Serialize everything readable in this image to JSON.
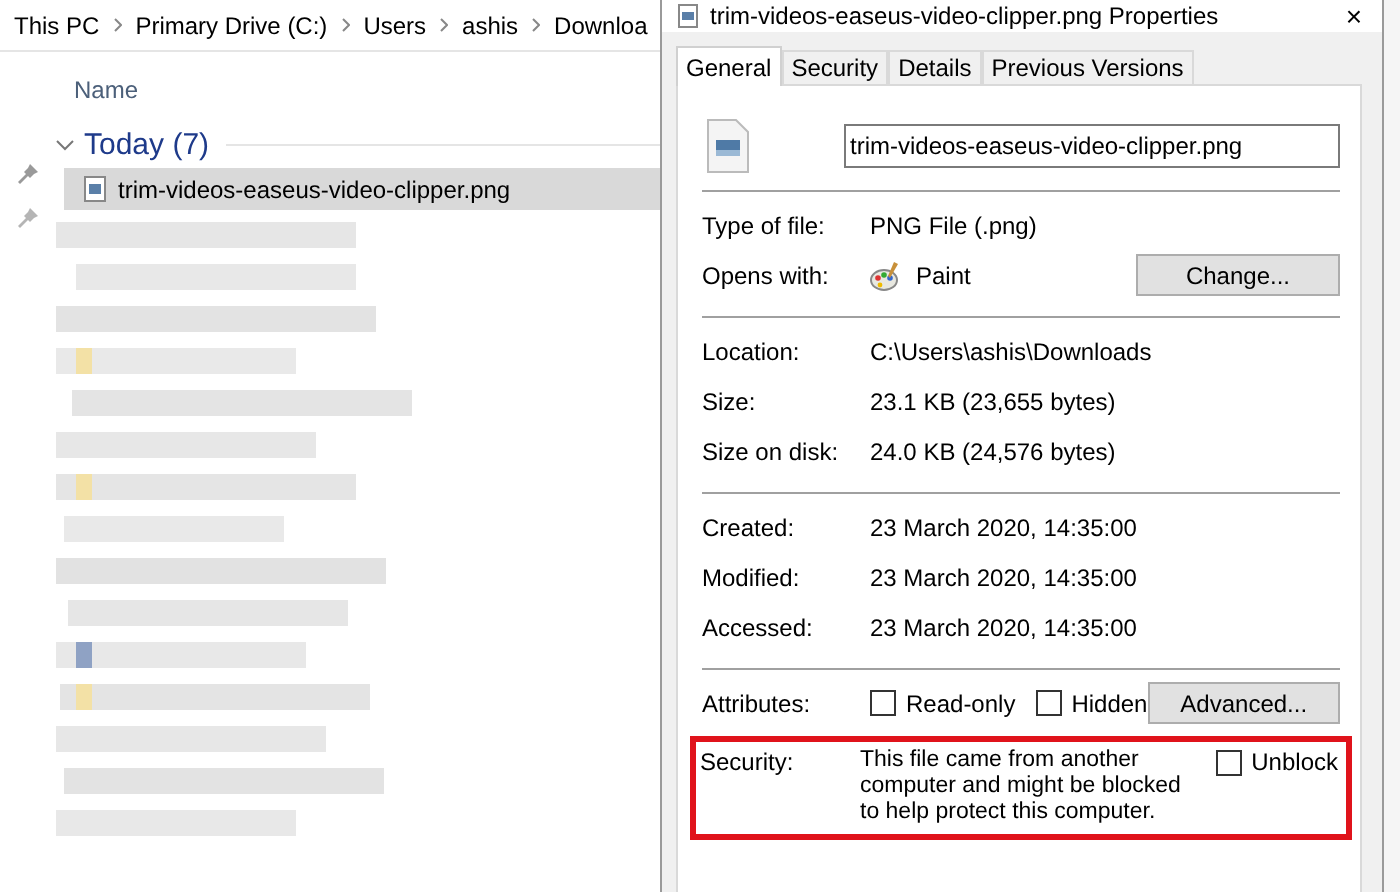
{
  "breadcrumb": [
    "This PC",
    "Primary Drive (C:)",
    "Users",
    "ashis",
    "Downloa"
  ],
  "column_header": "Name",
  "group": {
    "label": "Today (7)",
    "expanded": true
  },
  "files": [
    {
      "name": "trim-videos-easeus-video-clipper.png",
      "selected": true
    }
  ],
  "dialog": {
    "title": "trim-videos-easeus-video-clipper.png Properties",
    "close": "×",
    "tabs": [
      {
        "label": "General",
        "selected": true
      },
      {
        "label": "Security",
        "selected": false
      },
      {
        "label": "Details",
        "selected": false
      },
      {
        "label": "Previous Versions",
        "selected": false
      }
    ],
    "file_name": "trim-videos-easeus-video-clipper.png",
    "sections": [
      [
        {
          "kind": "text",
          "label": "Type of file:",
          "value": "PNG File (.png)"
        },
        {
          "kind": "app",
          "label": "Opens with:",
          "value": "Paint",
          "button": "Change..."
        }
      ],
      [
        {
          "kind": "text",
          "label": "Location:",
          "value": "C:\\Users\\ashis\\Downloads"
        },
        {
          "kind": "text",
          "label": "Size:",
          "value": "23.1 KB (23,655 bytes)"
        },
        {
          "kind": "text",
          "label": "Size on disk:",
          "value": "24.0 KB (24,576 bytes)"
        }
      ],
      [
        {
          "kind": "text",
          "label": "Created:",
          "value": "23 March 2020, 14:35:00"
        },
        {
          "kind": "text",
          "label": "Modified:",
          "value": "23 March 2020, 14:35:00"
        },
        {
          "kind": "text",
          "label": "Accessed:",
          "value": "23 March 2020, 14:35:00"
        }
      ],
      [
        {
          "kind": "attributes",
          "label": "Attributes:",
          "checks": [
            {
              "label": "Read-only",
              "checked": false
            },
            {
              "label": "Hidden",
              "checked": false
            }
          ],
          "button": "Advanced..."
        },
        {
          "kind": "security",
          "label": "Security:",
          "value": "This file came from another computer and might be blocked to help protect this computer.",
          "checks": [
            {
              "label": "Unblock",
              "checked": false
            }
          ],
          "highlighted": true
        }
      ]
    ]
  }
}
